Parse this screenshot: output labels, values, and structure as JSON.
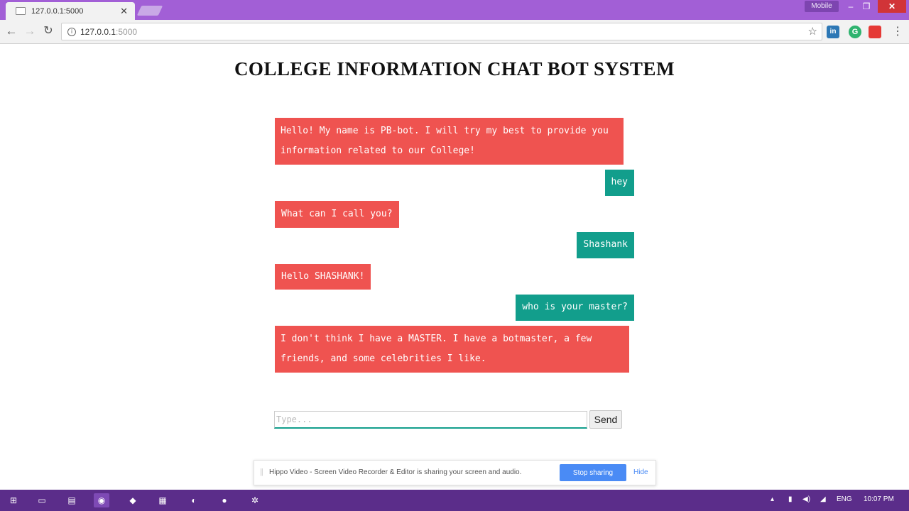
{
  "browser": {
    "tab_title": "127.0.0.1:5000",
    "tab_close": "✕",
    "profile": "Mobile",
    "url_host": "127.0.0.1",
    "url_port": ":5000",
    "window_min": "–",
    "window_max": "❐",
    "window_close": "✕",
    "extensions": [
      "linkedin-icon",
      "grammarly-icon",
      "toolbox-icon"
    ]
  },
  "page": {
    "title": "COLLEGE INFORMATION CHAT BOT SYSTEM"
  },
  "colors": {
    "bot_bubble": "#ef5350",
    "user_bubble": "#129e8c",
    "titlebar": "#a25fd6",
    "taskbar": "#5b2d8a"
  },
  "chat": {
    "messages": [
      {
        "sender": "bot",
        "text": " Hello! My name is PB-bot. I will try my best to provide you information related to our College!"
      },
      {
        "sender": "user",
        "text": "hey"
      },
      {
        "sender": "bot",
        "text": "What can I call you?"
      },
      {
        "sender": "user",
        "text": "Shashank"
      },
      {
        "sender": "bot",
        "text": "Hello SHASHANK!"
      },
      {
        "sender": "user",
        "text": "who is your master?"
      },
      {
        "sender": "bot",
        "text": " I don't think I have a MASTER. I have a botmaster, a few friends, and some celebrities I like."
      }
    ],
    "input_placeholder": "Type...",
    "input_value": "",
    "send_label": "Send"
  },
  "share_bar": {
    "message": "Hippo Video - Screen Video Recorder & Editor is sharing your screen and audio.",
    "stop_label": "Stop sharing",
    "hide_label": "Hide"
  },
  "taskbar": {
    "language": "ENG",
    "time": "10:07 PM"
  }
}
